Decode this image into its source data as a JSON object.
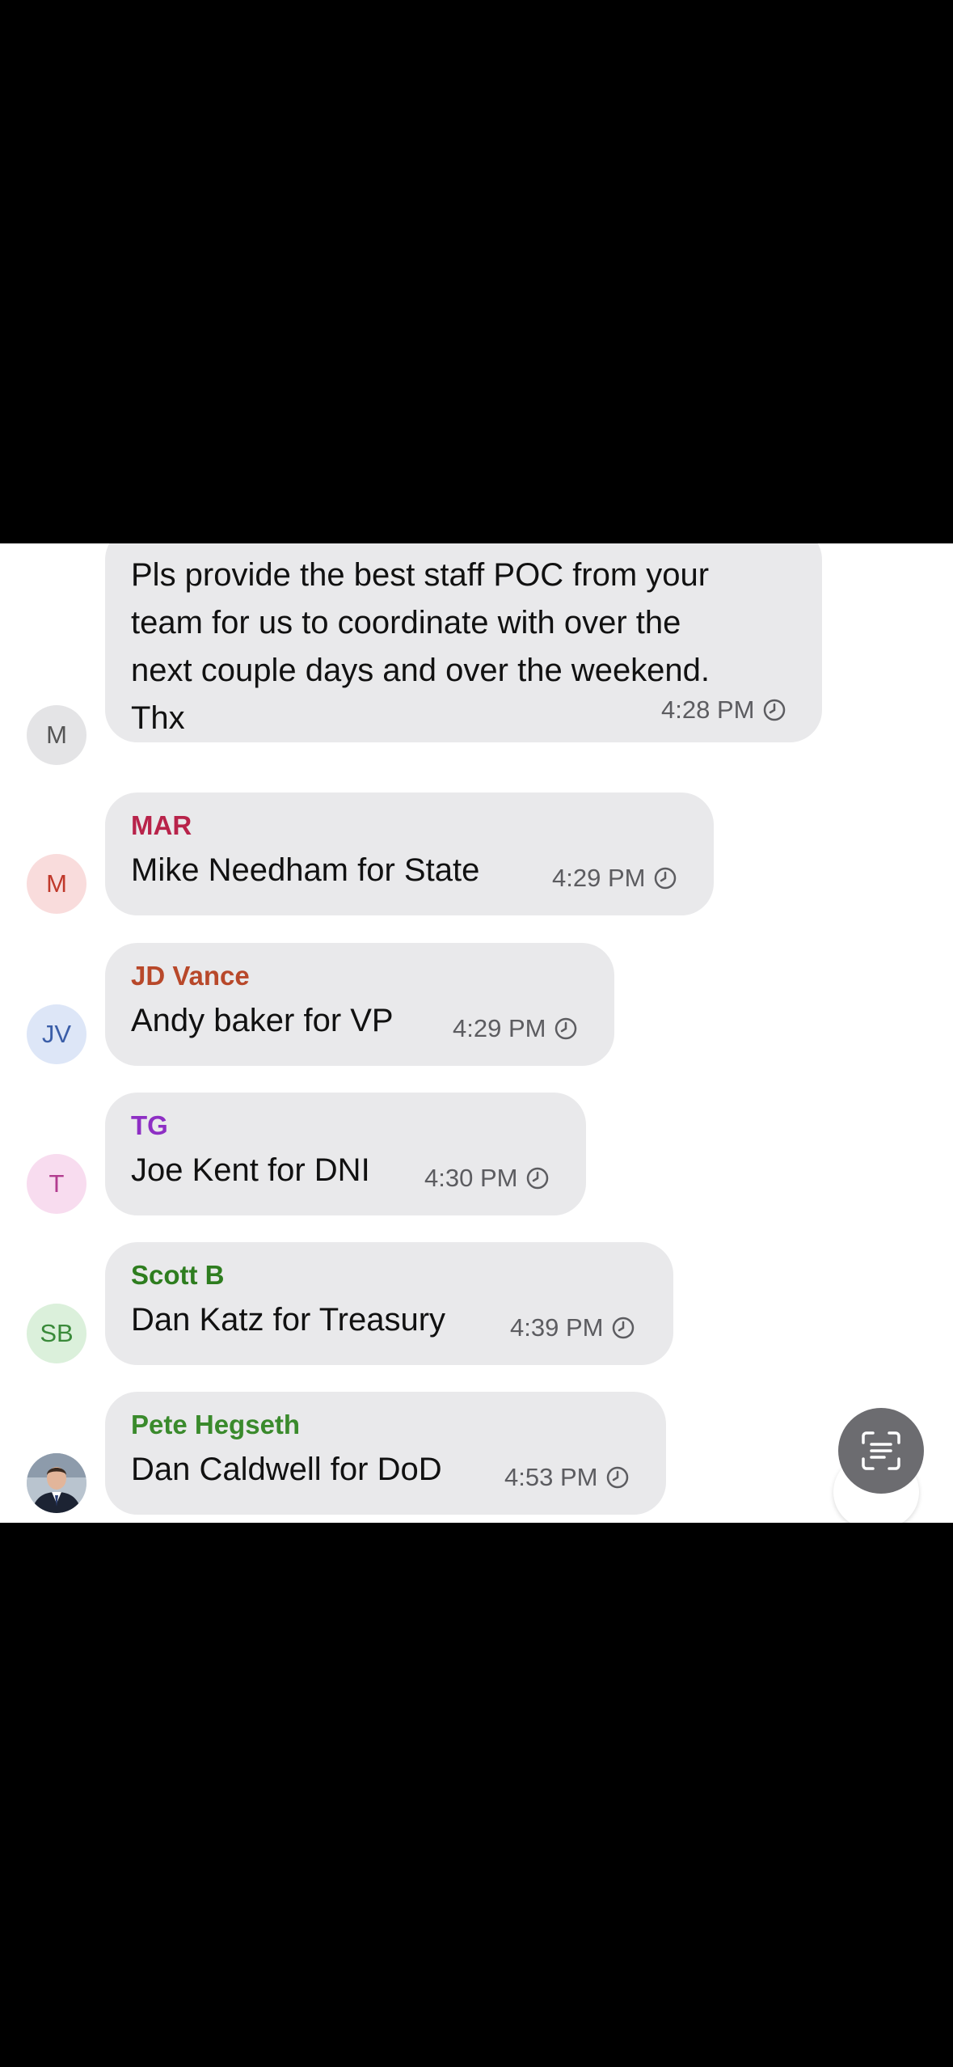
{
  "messages": [
    {
      "avatar_initials": "M",
      "avatar_bg": "#e4e4e6",
      "avatar_fg": "#555555",
      "sender": "",
      "sender_color": "",
      "lines": [
        "Pls provide the best staff POC from your",
        "team for us to coordinate with over the",
        "next couple days and over the weekend.",
        "Thx"
      ],
      "time": "4:28 PM"
    },
    {
      "avatar_initials": "M",
      "avatar_bg": "#f9dcdc",
      "avatar_fg": "#c0392b",
      "sender": "MAR",
      "sender_color": "#b8234a",
      "text": "Mike Needham for State",
      "time": "4:29 PM"
    },
    {
      "avatar_initials": "JV",
      "avatar_bg": "#dde6f7",
      "avatar_fg": "#3b5ea8",
      "sender": "JD Vance",
      "sender_color": "#b8482a",
      "text": "Andy baker for VP",
      "time": "4:29 PM"
    },
    {
      "avatar_initials": "T",
      "avatar_bg": "#f8dcef",
      "avatar_fg": "#b23c8f",
      "sender": "TG",
      "sender_color": "#8e2fc4",
      "text": "Joe Kent for DNI",
      "time": "4:30 PM"
    },
    {
      "avatar_initials": "SB",
      "avatar_bg": "#dbf0db",
      "avatar_fg": "#3a8a3a",
      "sender": "Scott B",
      "sender_color": "#2e7d1f",
      "text": "Dan Katz for Treasury",
      "time": "4:39 PM"
    },
    {
      "avatar_initials": "",
      "avatar_icon": "profile-photo",
      "sender": "Pete Hegseth",
      "sender_color": "#3a8a2c",
      "text": "Dan Caldwell for DoD",
      "time": "4:53 PM"
    }
  ],
  "icons": {
    "delivered": "clock-icon",
    "scan": "text-scan-icon",
    "scroll": "scroll-down-button"
  }
}
